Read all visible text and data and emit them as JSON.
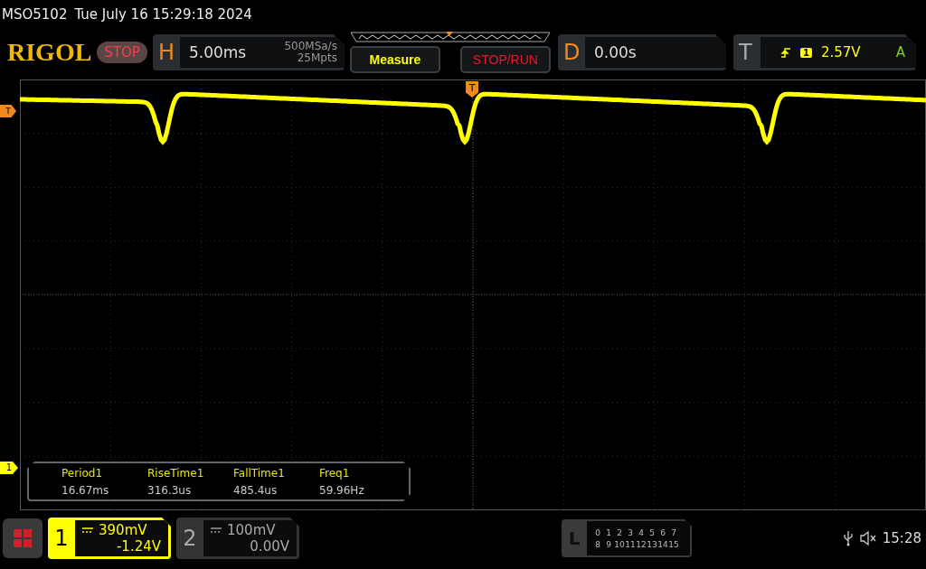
{
  "header": {
    "model": "MSO5102",
    "datetime": "Tue July 16 15:29:18 2024"
  },
  "toolbar": {
    "logo": "RIGOL",
    "run_state": "STOP",
    "horizontal": {
      "label": "H",
      "timebase": "5.00ms",
      "sample_rate": "500MSa/s",
      "memory_depth": "25Mpts"
    },
    "buttons": [
      {
        "label": "Measure",
        "kind": "measure"
      },
      {
        "label": "STOP/RUN",
        "kind": "run"
      }
    ],
    "delay": {
      "label": "D",
      "value": "0.00s"
    },
    "trigger": {
      "label": "T",
      "source": "1",
      "level": "2.57V",
      "mode": "A"
    }
  },
  "screen": {
    "trigger_marker": "T",
    "trigger_position_marker": "T",
    "channel_marker": "1",
    "measurements": [
      {
        "name": "Period1",
        "value": "16.67ms"
      },
      {
        "name": "RiseTime1",
        "value": "316.3us"
      },
      {
        "name": "FallTime1",
        "value": "485.4us"
      },
      {
        "name": "Freq1",
        "value": "59.96Hz"
      }
    ]
  },
  "channels": [
    {
      "number": "1",
      "scale": "390mV",
      "offset": "-1.24V",
      "selected": true
    },
    {
      "number": "2",
      "scale": "100mV",
      "offset": "0.00V",
      "selected": false
    }
  ],
  "logic": {
    "label": "L",
    "rows": [
      [
        "0",
        "1",
        "2",
        "3",
        "4",
        "5",
        "6",
        "7"
      ],
      [
        "8",
        "9",
        "10",
        "11",
        "12",
        "13",
        "14",
        "15"
      ]
    ]
  },
  "status": {
    "time": "15:28"
  }
}
